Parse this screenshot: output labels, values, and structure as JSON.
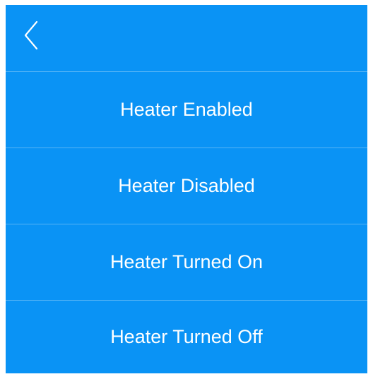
{
  "header": {
    "back_icon": "chevron-left-icon"
  },
  "colors": {
    "background": "#0a93f5",
    "divider": "#55b4f6",
    "text": "#ffffff"
  },
  "menu": {
    "items": [
      {
        "label": "Heater Enabled"
      },
      {
        "label": "Heater Disabled"
      },
      {
        "label": "Heater Turned On"
      },
      {
        "label": "Heater Turned Off"
      }
    ]
  }
}
